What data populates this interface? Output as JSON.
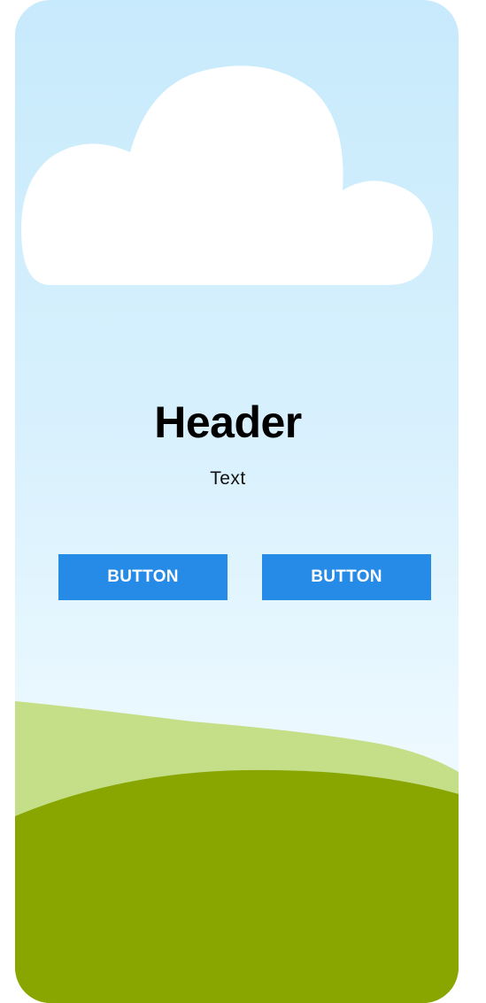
{
  "screen": {
    "header": "Header",
    "text": "Text"
  },
  "buttons": [
    {
      "label": "BUTTON"
    },
    {
      "label": "BUTTON"
    }
  ],
  "colors": {
    "sky_top": "#c7eafc",
    "sky_bottom": "#f4fbff",
    "cloud": "#ffffff",
    "hill_back": "#c4df87",
    "hill_front": "#88a500",
    "button": "#258be6",
    "button_text": "#ffffff"
  },
  "icons": {
    "cloud": "cloud-illustration",
    "hills": "hills-illustration"
  }
}
